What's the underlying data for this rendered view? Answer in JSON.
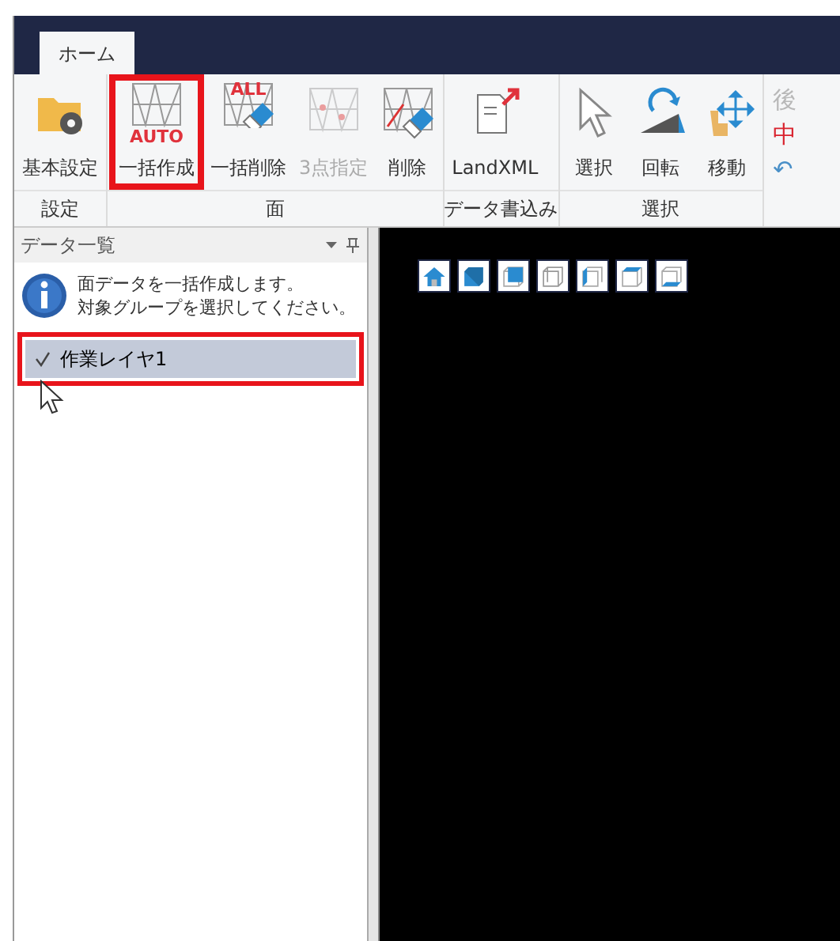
{
  "tabs": [
    {
      "label": "ホーム",
      "selected": true
    }
  ],
  "ribbon_groups": [
    {
      "label": "設定",
      "buttons": [
        {
          "label": "基本設定",
          "kind": "folder-gear",
          "disabled": false,
          "highlighted": false
        }
      ]
    },
    {
      "label": "面",
      "buttons": [
        {
          "label": "一括作成",
          "kind": "mesh-auto",
          "badge": "AUTO",
          "disabled": false,
          "highlighted": true
        },
        {
          "label": "一括削除",
          "kind": "mesh-erase-all",
          "badge": "ALL",
          "disabled": false,
          "highlighted": false
        },
        {
          "label": "3点指定",
          "kind": "mesh-points",
          "disabled": true,
          "highlighted": false
        },
        {
          "label": "削除",
          "kind": "mesh-erase",
          "disabled": false,
          "highlighted": false
        }
      ]
    },
    {
      "label": "データ書込み",
      "buttons": [
        {
          "label": "LandXML",
          "kind": "export",
          "disabled": false,
          "highlighted": false
        }
      ]
    },
    {
      "label": "選択",
      "buttons": [
        {
          "label": "選択",
          "kind": "pointer",
          "disabled": false,
          "highlighted": false
        },
        {
          "label": "回転",
          "kind": "rotate",
          "disabled": false,
          "highlighted": false
        },
        {
          "label": "移動",
          "kind": "move",
          "disabled": false,
          "highlighted": false
        }
      ]
    }
  ],
  "side_commands": [
    {
      "glyph": "後",
      "color": "#b8b8b8"
    },
    {
      "glyph": "中",
      "color": "#d9232e"
    },
    {
      "glyph": "↶",
      "color": "#4a90c8"
    }
  ],
  "panel": {
    "title": "データ一覧",
    "message": [
      "面データを一括作成します。",
      "対象グループを選択してください。"
    ],
    "items": [
      {
        "label": "作業レイヤ1",
        "checked": true,
        "selected": true,
        "highlighted": true
      }
    ]
  },
  "view_buttons": [
    {
      "kind": "home"
    },
    {
      "kind": "front"
    },
    {
      "kind": "back"
    },
    {
      "kind": "left"
    },
    {
      "kind": "right"
    },
    {
      "kind": "top"
    },
    {
      "kind": "bottom"
    }
  ]
}
